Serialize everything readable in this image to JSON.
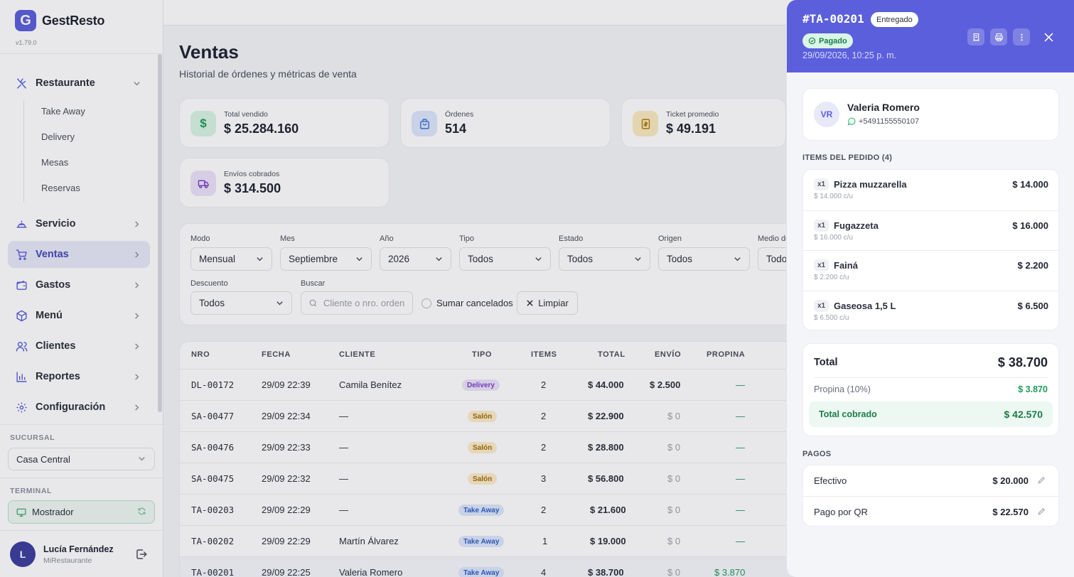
{
  "app": {
    "logo_letter": "G",
    "name": "GestResto",
    "version": "v1.79.0"
  },
  "sidebar": {
    "nav": [
      {
        "label": "Restaurante",
        "icon": "utensils-icon"
      },
      {
        "label": "Servicio",
        "icon": "cloche-icon"
      },
      {
        "label": "Ventas",
        "icon": "cart-icon"
      },
      {
        "label": "Gastos",
        "icon": "wallet-icon"
      },
      {
        "label": "Menú",
        "icon": "box-icon"
      },
      {
        "label": "Clientes",
        "icon": "users-icon"
      },
      {
        "label": "Reportes",
        "icon": "chart-icon"
      },
      {
        "label": "Configuración",
        "icon": "gear-icon"
      }
    ],
    "sub_items": [
      "Take Away",
      "Delivery",
      "Mesas",
      "Reservas"
    ],
    "branch_label": "SUCURSAL",
    "branch_value": "Casa Central",
    "terminal_label": "TERMINAL",
    "terminal_value": "Mostrador",
    "user": {
      "initial": "L",
      "name": "Lucía Fernández",
      "org": "MiRestaurante"
    }
  },
  "page": {
    "title": "Ventas",
    "subtitle": "Historial de órdenes y métricas de venta"
  },
  "stats": [
    {
      "label": "Total vendido",
      "value": "$ 25.284.160",
      "icon": "dollar-icon",
      "color": "#1e9a5a",
      "bg": "#d9f4e5"
    },
    {
      "label": "Órdenes",
      "value": "514",
      "icon": "bag-icon",
      "color": "#3b6fd8",
      "bg": "#dde7fb"
    },
    {
      "label": "Ticket promedio",
      "value": "$ 49.191",
      "icon": "receipt-icon",
      "color": "#b07a05",
      "bg": "#fbeac0"
    },
    {
      "label": "Envíos cobrados",
      "value": "$ 314.500",
      "icon": "truck-icon",
      "color": "#7a3fc8",
      "bg": "#ede3fa"
    }
  ],
  "filters": {
    "modo": {
      "label": "Modo",
      "value": "Mensual"
    },
    "mes": {
      "label": "Mes",
      "value": "Septiembre"
    },
    "anio": {
      "label": "Año",
      "value": "2026"
    },
    "tipo": {
      "label": "Tipo",
      "value": "Todos"
    },
    "estado": {
      "label": "Estado",
      "value": "Todos"
    },
    "origen": {
      "label": "Origen",
      "value": "Todos"
    },
    "medio": {
      "label": "Medio de",
      "value": "Todo"
    },
    "descuento": {
      "label": "Descuento",
      "value": "Todos"
    },
    "buscar": {
      "label": "Buscar",
      "placeholder": "Cliente o nro. orden"
    },
    "sumar_cancelados": "Sumar cancelados",
    "limpiar": "Limpiar"
  },
  "table": {
    "headers": [
      "NRO",
      "FECHA",
      "CLIENTE",
      "TIPO",
      "ITEMS",
      "TOTAL",
      "ENVÍO",
      "PROPINA"
    ],
    "rows": [
      {
        "nro": "DL-00172",
        "fecha": "29/09 22:39",
        "cliente": "Camila Benítez",
        "tipo": "Delivery",
        "items": "2",
        "total": "$ 44.000",
        "envio": "$ 2.500",
        "propina": "—"
      },
      {
        "nro": "SA-00477",
        "fecha": "29/09 22:34",
        "cliente": "—",
        "tipo": "Salón",
        "items": "2",
        "total": "$ 22.900",
        "envio": "$ 0",
        "propina": "—"
      },
      {
        "nro": "SA-00476",
        "fecha": "29/09 22:33",
        "cliente": "—",
        "tipo": "Salón",
        "items": "2",
        "total": "$ 28.800",
        "envio": "$ 0",
        "propina": "—"
      },
      {
        "nro": "SA-00475",
        "fecha": "29/09 22:32",
        "cliente": "—",
        "tipo": "Salón",
        "items": "3",
        "total": "$ 56.800",
        "envio": "$ 0",
        "propina": "—"
      },
      {
        "nro": "TA-00203",
        "fecha": "29/09 22:29",
        "cliente": "—",
        "tipo": "Take Away",
        "items": "2",
        "total": "$ 21.600",
        "envio": "$ 0",
        "propina": "—"
      },
      {
        "nro": "TA-00202",
        "fecha": "29/09 22:29",
        "cliente": "Martín Álvarez",
        "tipo": "Take Away",
        "items": "1",
        "total": "$ 19.000",
        "envio": "$ 0",
        "propina": "—"
      },
      {
        "nro": "TA-00201",
        "fecha": "29/09 22:25",
        "cliente": "Valeria Romero",
        "tipo": "Take Away",
        "items": "4",
        "total": "$ 38.700",
        "envio": "$ 0",
        "propina": "$ 3.870"
      }
    ]
  },
  "panel": {
    "order_id": "#TA-00201",
    "status": "Entregado",
    "payment_status": "Pagado",
    "date": "29/09/2026, 10:25 p. m.",
    "customer": {
      "initials": "VR",
      "name": "Valeria Romero",
      "phone": "+5491155550107"
    },
    "items_title": "ITEMS DEL PEDIDO (4)",
    "items": [
      {
        "qty": "x1",
        "name": "Pizza muzzarella",
        "unit": "$ 14.000 c/u",
        "price": "$ 14.000"
      },
      {
        "qty": "x1",
        "name": "Fugazzeta",
        "unit": "$ 16.000 c/u",
        "price": "$ 16.000"
      },
      {
        "qty": "x1",
        "name": "Fainá",
        "unit": "$ 2.200 c/u",
        "price": "$ 2.200"
      },
      {
        "qty": "x1",
        "name": "Gaseosa 1,5 L",
        "unit": "$ 6.500 c/u",
        "price": "$ 6.500"
      }
    ],
    "total_label": "Total",
    "total_value": "$ 38.700",
    "tip_label": "Propina (10%)",
    "tip_value": "$ 3.870",
    "collected_label": "Total cobrado",
    "collected_value": "$ 42.570",
    "payments_title": "PAGOS",
    "payments": [
      {
        "name": "Efectivo",
        "amount": "$ 20.000"
      },
      {
        "name": "Pago por QR",
        "amount": "$ 22.570"
      }
    ]
  }
}
